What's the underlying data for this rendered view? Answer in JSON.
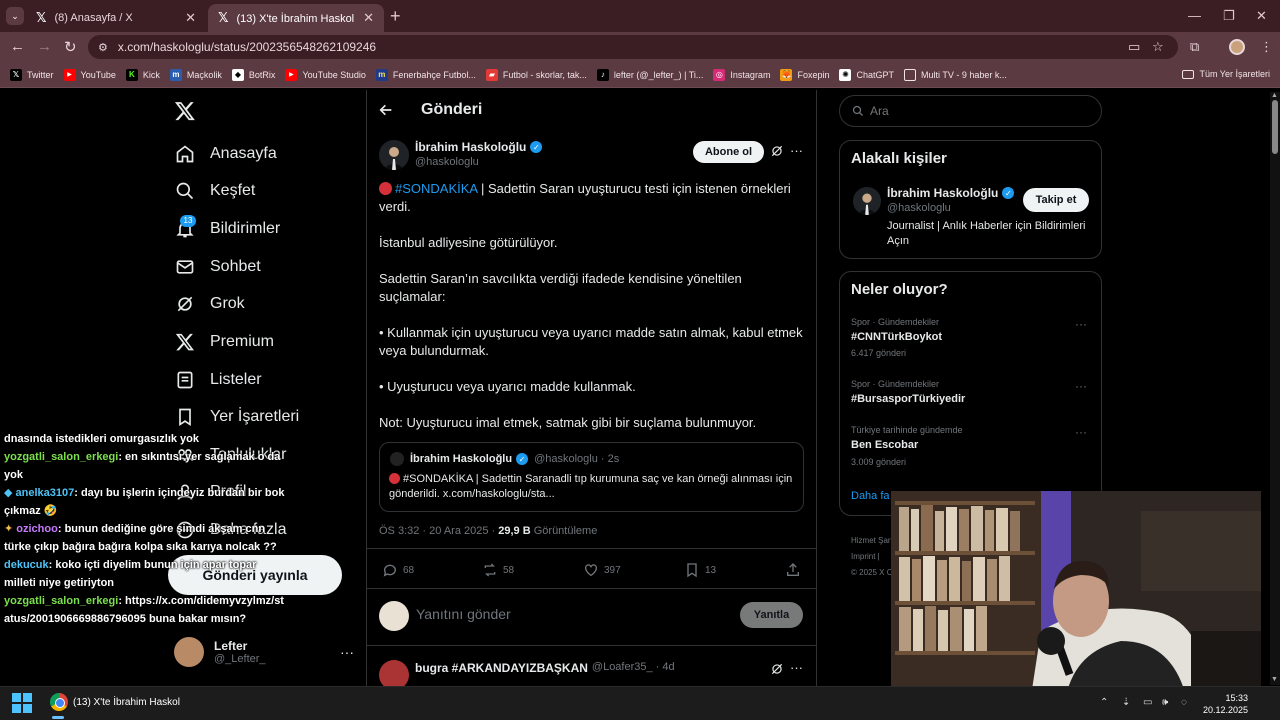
{
  "browser": {
    "tabs": [
      {
        "title": "(8) Anasayfa / X"
      },
      {
        "title": "(13) X'te İbrahim Haskoloğlu: \"🔴"
      }
    ],
    "url": "x.com/haskologlu/status/2002356548262109246",
    "bookmarks": [
      "Twitter",
      "YouTube",
      "Kick",
      "Maçkolik",
      "BotRix",
      "YouTube Studio",
      "Fenerbahçe Futbol...",
      "Futbol - skorlar, tak...",
      "lefter (@_lefter_) | Ti...",
      "Instagram",
      "Foxepin",
      "ChatGPT",
      "Multi TV - 9 haber k..."
    ],
    "all_bookmarks": "Tüm Yer İşaretleri"
  },
  "nav": {
    "items": [
      "Anasayfa",
      "Keşfet",
      "Bildirimler",
      "Sohbet",
      "Grok",
      "Premium",
      "Listeler",
      "Yer İşaretleri",
      "Topluluklar",
      "Profil",
      "Daha fazla"
    ],
    "badge": "13",
    "post_button": "Gönderi yayınla",
    "me_name": "Lefter",
    "me_handle": "@_Lefter_"
  },
  "chat": [
    {
      "user": "",
      "color": "#ffffff",
      "text": "dnasında istedikleri omurgasızlık yok"
    },
    {
      "user": "yozgatli_salon_erkegi",
      "color": "#7be04d",
      "text": ": en sıkıntısı yer saglamak o da yok"
    },
    {
      "user": "anelka3107",
      "color": "#4fc3f7",
      "text": ": dayı bu işlerin içindeyiz burdan bir bok çıkmaz 🤣"
    },
    {
      "user": "ozichoo",
      "color": "#c879ff",
      "text": ": bunun dediğine göre şimdi akşam cnn türke çıkıp bağıra bağıra kolpa sıka karıya nolcak ??"
    },
    {
      "user": "dekucuk",
      "color": "#4fc3f7",
      "text": ": koko içti diyelim bunun için apar topar milleti niye getiriyton"
    },
    {
      "user": "yozgatli_salon_erkegi",
      "color": "#7be04d",
      "text": ": https://x.com/didemyvzylmz/status/2001906669886796095 buna bakar mısın?"
    }
  ],
  "post": {
    "header_title": "Gönderi",
    "author_name": "İbrahim Haskoloğlu",
    "author_handle": "@haskologlu",
    "subscribe_label": "Abone ol",
    "hashtag": "#SONDAKİKA",
    "line1_rest": " | Sadettin Saran uyuşturucu testi için istenen örnekleri verdi.",
    "para2": "İstanbul adliyesine götürülüyor.",
    "para3": "Sadettin Saran’ın savcılıkta verdiği ifadede kendisine yöneltilen suçlamalar:",
    "para4": "• Kullanmak için uyuşturucu veya uyarıcı madde satın almak, kabul etmek veya bulundurmak.",
    "para5": "• Uyuşturucu veya uyarıcı madde kullanmak.",
    "para6": "Not: Uyuşturucu imal etmek, satmak gibi bir suçlama bulunmuyor.",
    "quote": {
      "name": "İbrahim Haskoloğlu",
      "meta": "@haskologlu · 2s",
      "hashtag": "#SONDAKİKA",
      "text": " | Sadettin Saranadli tıp kurumuna saç ve kan örneği alınması için gönderildi. x.com/haskologlu/sta..."
    },
    "time": "ÖS 3:32 · 20 Ara 2025 · ",
    "views_count": "29,9 B",
    "views_label": " Görüntüleme",
    "replies": "68",
    "reposts": "58",
    "likes": "397",
    "bookmarks": "13",
    "reply_placeholder": "Yanıtını gönder",
    "reply_button": "Yanıtla",
    "next_reply": {
      "name": "bugra #ARKANDAYIZBAŞKAN",
      "meta": "@Loafer35_ · 4d"
    }
  },
  "sidebar": {
    "search_placeholder": "Ara",
    "related_title": "Alakalı kişiler",
    "related_name": "İbrahim Haskoloğlu",
    "related_handle": "@haskologlu",
    "related_bio": "Journalist | Anlık Haberler için Bildirimleri Açın",
    "follow_label": "Takip et",
    "trends_title": "Neler oluyor?",
    "trends": [
      {
        "category": "Spor · Gündemdekiler",
        "name": "#CNNTürkBoykot",
        "count": "6.417 gönderi"
      },
      {
        "category": "Spor · Gündemdekiler",
        "name": "#BursasporTürkiyedir",
        "count": ""
      },
      {
        "category": "Türkiye tarihinde gündemde",
        "name": "Ben Escobar",
        "count": "3.009 gönderi"
      }
    ],
    "show_more": "Daha fazla göster",
    "footer": [
      "Hizmet Şartları",
      "Imprint |",
      "© 2025 X Corp."
    ]
  },
  "taskbar": {
    "app_label": "(13) X'te İbrahim Haskol",
    "time": "15:33",
    "date": "20.12.2025"
  },
  "colors": {
    "accent": "#1d9bf0",
    "tab_bg": "#3a1e24",
    "toolbar_bg": "#5b3a41",
    "breaking_dot": "#d6303a"
  }
}
